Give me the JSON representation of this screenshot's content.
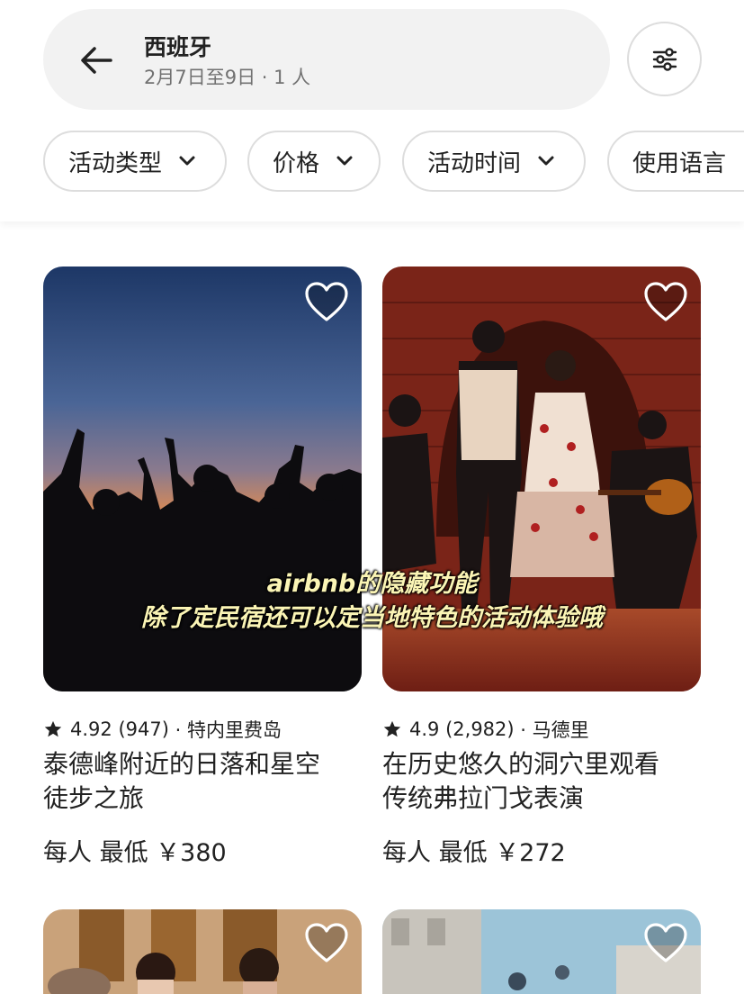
{
  "search": {
    "title": "西班牙",
    "subtitle": "2月7日至9日 · 1 人"
  },
  "icons": {
    "back": "arrow-left-icon",
    "filter": "sliders-icon",
    "chevron": "chevron-down-icon",
    "heart": "heart-outline-icon",
    "star": "star-filled-icon"
  },
  "chips": [
    "活动类型",
    "价格",
    "活动时间",
    "使用语言"
  ],
  "cards": [
    {
      "rating": "4.92",
      "reviews": "(947)",
      "location": "· 特内里费岛",
      "title_line1": "泰德峰附近的日落和星空",
      "title_line2": "徒步之旅",
      "price": "每人 最低 ￥380"
    },
    {
      "rating": "4.9",
      "reviews": "(2,982)",
      "location": "· 马德里",
      "title_line1": "在历史悠久的洞穴里观看",
      "title_line2": "传统弗拉门戈表演",
      "price": "每人 最低 ￥272"
    }
  ],
  "caption": {
    "line1": "airbnb的隐藏功能",
    "line2": "除了定民宿还可以定当地特色的活动体验哦"
  },
  "colors": {
    "text": "#222222",
    "muted": "#717171",
    "border": "#dddddd",
    "pill_bg": "#f2f2f2",
    "caption": "#fbf5b5"
  }
}
